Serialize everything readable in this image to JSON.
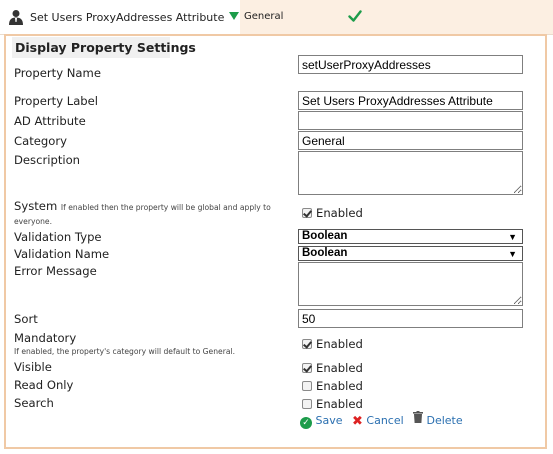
{
  "topbar": {
    "title": "Set Users ProxyAddresses Attribute",
    "category": "General"
  },
  "panel": {
    "heading": "Display Property Settings"
  },
  "fields": {
    "property_name": {
      "label": "Property Name",
      "value": "setUserProxyAddresses"
    },
    "property_label": {
      "label": "Property Label",
      "value": "Set Users ProxyAddresses Attribute"
    },
    "ad_attribute": {
      "label": "AD Attribute",
      "value": ""
    },
    "category": {
      "label": "Category",
      "value": "General"
    },
    "description": {
      "label": "Description",
      "value": ""
    },
    "system": {
      "label": "System",
      "hint": "If enabled then the property will be global and apply to everyone.",
      "checked": true,
      "option": "Enabled"
    },
    "validation_type": {
      "label": "Validation Type",
      "value": "Boolean"
    },
    "validation_name": {
      "label": "Validation Name",
      "value": "Boolean"
    },
    "error_message": {
      "label": "Error Message",
      "value": ""
    },
    "sort": {
      "label": "Sort",
      "value": "50"
    },
    "mandatory": {
      "label": "Mandatory",
      "hint": "If enabled, the property's category will default to General.",
      "checked": true,
      "option": "Enabled"
    },
    "visible": {
      "label": "Visible",
      "checked": true,
      "option": "Enabled"
    },
    "read_only": {
      "label": "Read Only",
      "checked": false,
      "option": "Enabled"
    },
    "search": {
      "label": "Search",
      "checked": false,
      "option": "Enabled"
    }
  },
  "actions": {
    "save": "Save",
    "cancel": "Cancel",
    "delete": "Delete"
  },
  "icons": {
    "user": "user-icon",
    "expand": "triangle-down-icon",
    "status": "checkmark-icon",
    "save": "check-circle-icon",
    "cancel": "x-icon",
    "delete": "trash-icon"
  },
  "colors": {
    "accent_green": "#1c9c4a",
    "cancel_red": "#dd2222",
    "link_blue": "#2a6fb0",
    "panel_border": "#f0c9a5",
    "topbar_bg": "#fcefe2"
  }
}
